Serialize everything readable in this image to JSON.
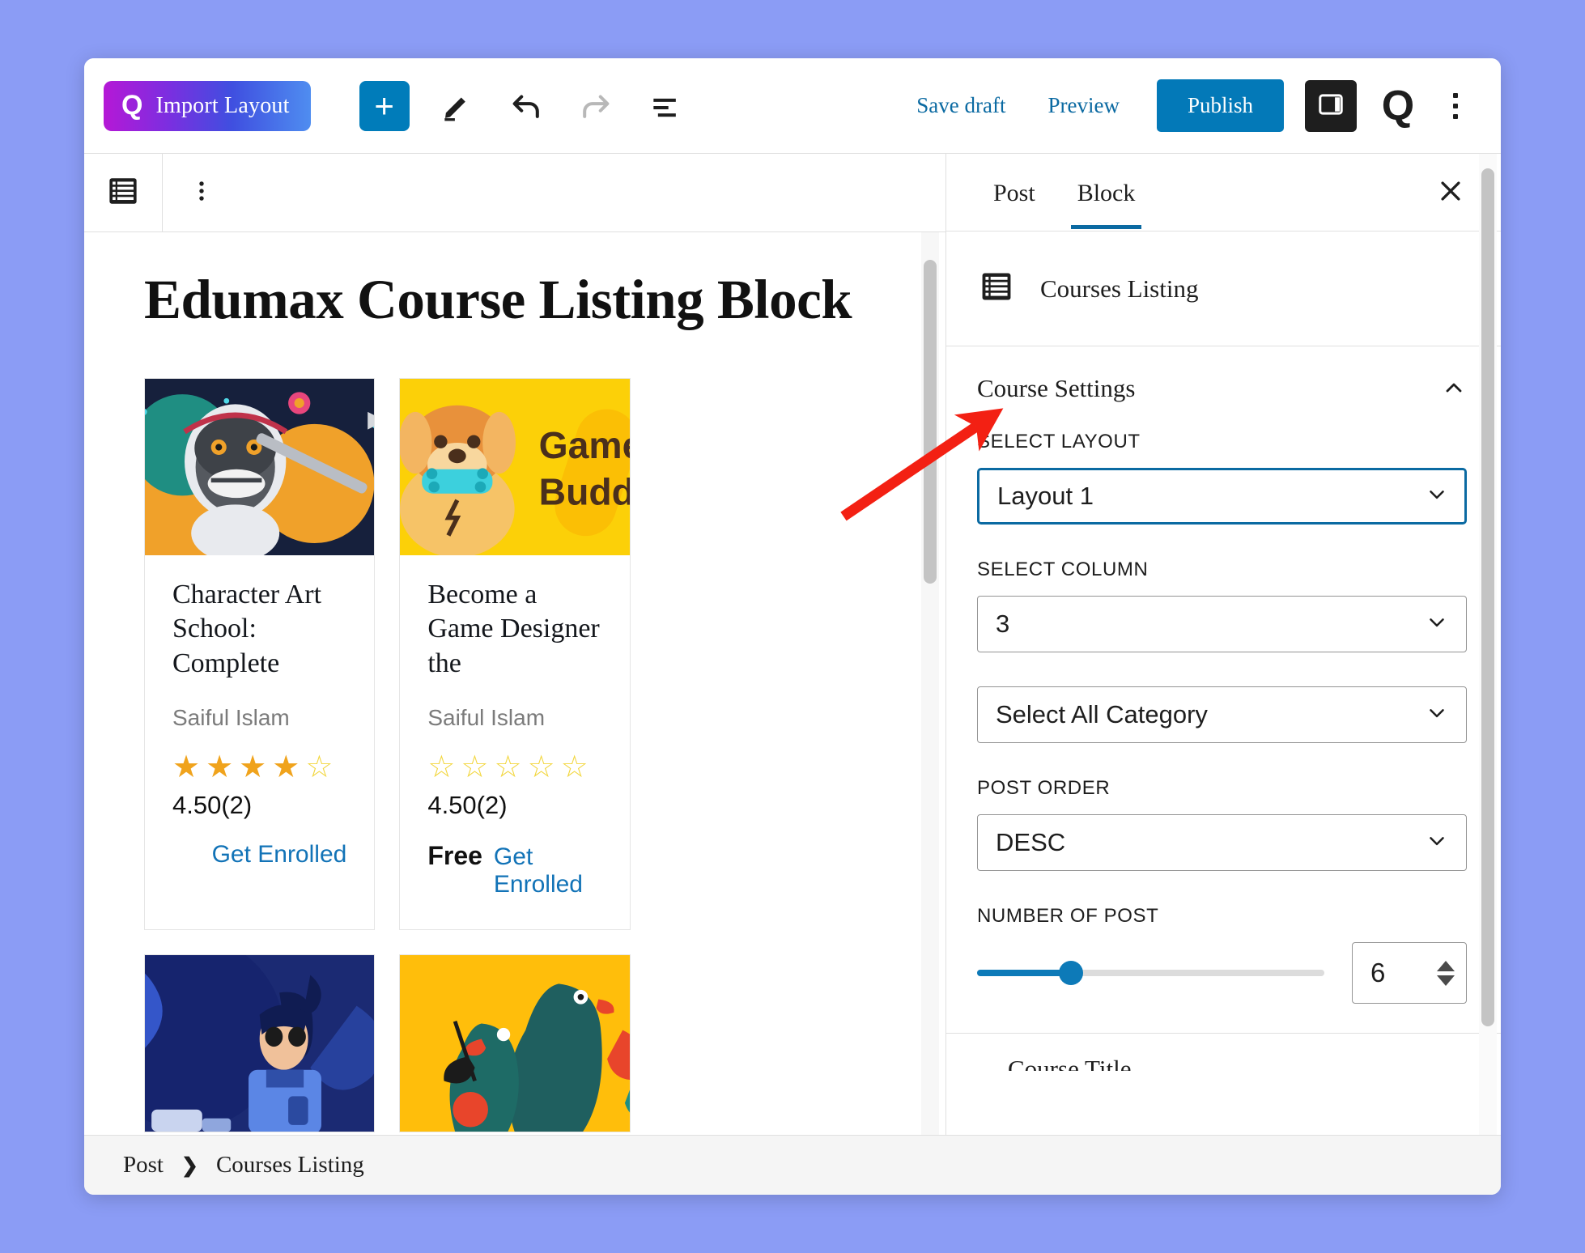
{
  "toolbar": {
    "import_layout_label": "Import Layout",
    "import_layout_logo": "Q",
    "add_block_label": "+",
    "edit_icon": "pencil-icon",
    "undo_icon": "undo-arrow-icon",
    "redo_icon": "redo-arrow-icon",
    "list_view_icon": "document-overview-icon",
    "save_draft_label": "Save draft",
    "preview_label": "Preview",
    "publish_label": "Publish",
    "sidebar_toggle_icon": "settings-panel-icon",
    "plugin_logo": "Q",
    "options_icon": "kebab-menu-icon"
  },
  "block_toolbar": {
    "block_type_icon": "courses-listing-block-icon",
    "more_options_icon": "kebab-menu-icon"
  },
  "editor": {
    "post_title": "Edumax Course Listing Block",
    "courses": [
      {
        "title": "Character Art School: Complete",
        "author": "Saiful Islam",
        "stars_filled": 4,
        "stars_total": 5,
        "rating": "4.50(2)",
        "price": "",
        "enroll_label": "Get Enrolled",
        "thumb": "space-monkey-astronaut"
      },
      {
        "title": "Become a Game Designer the",
        "author": "Saiful Islam",
        "stars_filled": 0,
        "stars_total": 5,
        "rating": "4.50(2)",
        "price": "Free",
        "enroll_label": "Get Enrolled",
        "thumb": "game-buddy-dog"
      },
      {
        "title": "",
        "author": "",
        "stars_filled": 0,
        "stars_total": 0,
        "rating": "",
        "price": "",
        "enroll_label": "",
        "thumb": "night-girl-laptop"
      },
      {
        "title": "",
        "author": "",
        "stars_filled": 0,
        "stars_total": 0,
        "rating": "",
        "price": "",
        "enroll_label": "",
        "thumb": "birds-yellow"
      }
    ],
    "star_glyph_full": "★",
    "star_glyph_empty": "☆"
  },
  "sidebar": {
    "tabs": [
      {
        "label": "Post",
        "active": false
      },
      {
        "label": "Block",
        "active": true
      }
    ],
    "close_icon": "close-icon",
    "block_card": {
      "icon": "courses-listing-block-icon",
      "name": "Courses Listing"
    },
    "panel": {
      "title": "Course Settings",
      "collapse_icon": "chevron-up-icon",
      "fields": {
        "select_layout_label": "SELECT LAYOUT",
        "select_layout_value": "Layout 1",
        "select_column_label": "SELECT COLUMN",
        "select_column_value": "3",
        "category_value": "Select All Category",
        "post_order_label": "POST ORDER",
        "post_order_value": "DESC",
        "number_of_post_label": "NUMBER OF POST",
        "number_of_post_value": "6",
        "number_of_post_percent": 27
      }
    },
    "next_panel_title": "Course Title"
  },
  "breadcrumb": {
    "items": [
      "Post",
      "Courses Listing"
    ],
    "separator": "❯"
  },
  "colors": {
    "accent_blue": "#007cba",
    "publish_blue": "#0379b8",
    "link_blue": "#0b6aa2",
    "page_background": "#8b9cf5",
    "annotation_red": "#f32013",
    "star_full": "#f0a31c",
    "star_empty": "#f2d63c"
  }
}
